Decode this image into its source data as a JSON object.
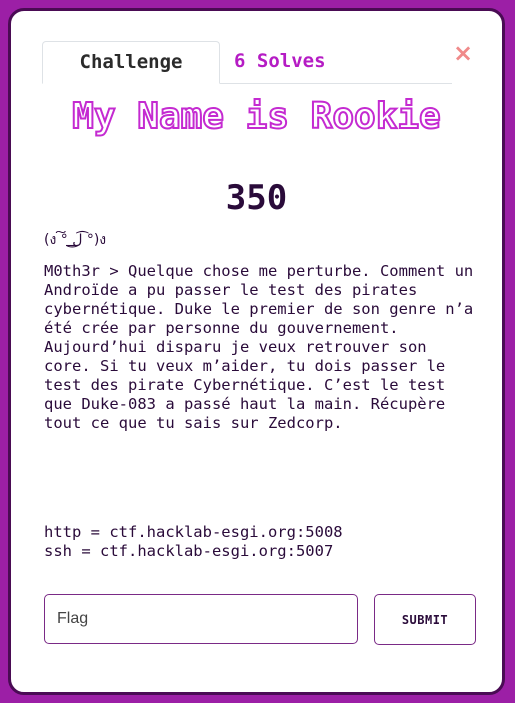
{
  "modal": {
    "close_glyph": "×",
    "tabs": [
      {
        "label": "Challenge",
        "active": true
      },
      {
        "label": "6 Solves",
        "active": false
      }
    ],
    "challenge": {
      "name": "My Name is Rookie",
      "value": "350",
      "kaomoji": "(ง ͠° ͟ل͜ ͡°)ง",
      "description": "M0th3r > Quelque chose me perturbe. Comment un Androïde a pu passer le test des pirates cybernétique. Duke le premier de son genre n’a été crée par personne du gouvernement. Aujourd’hui disparu je veux retrouver son core. Si tu veux m’aider, tu dois passer le test des pirate Cybernétique. C’est le test que Duke-083 a passé haut la main. Récupère tout ce que tu sais sur Zedcorp.",
      "connection": [
        "http = ctf.hacklab-esgi.org:5008",
        "ssh = ctf.hacklab-esgi.org:5007"
      ]
    },
    "form": {
      "flag_placeholder": "Flag",
      "submit_label": "SUBMIT"
    }
  },
  "colors": {
    "background": "#9c1fa6",
    "accent": "#b51cc4",
    "text": "#2a0b3a",
    "close": "#f08a8a"
  }
}
